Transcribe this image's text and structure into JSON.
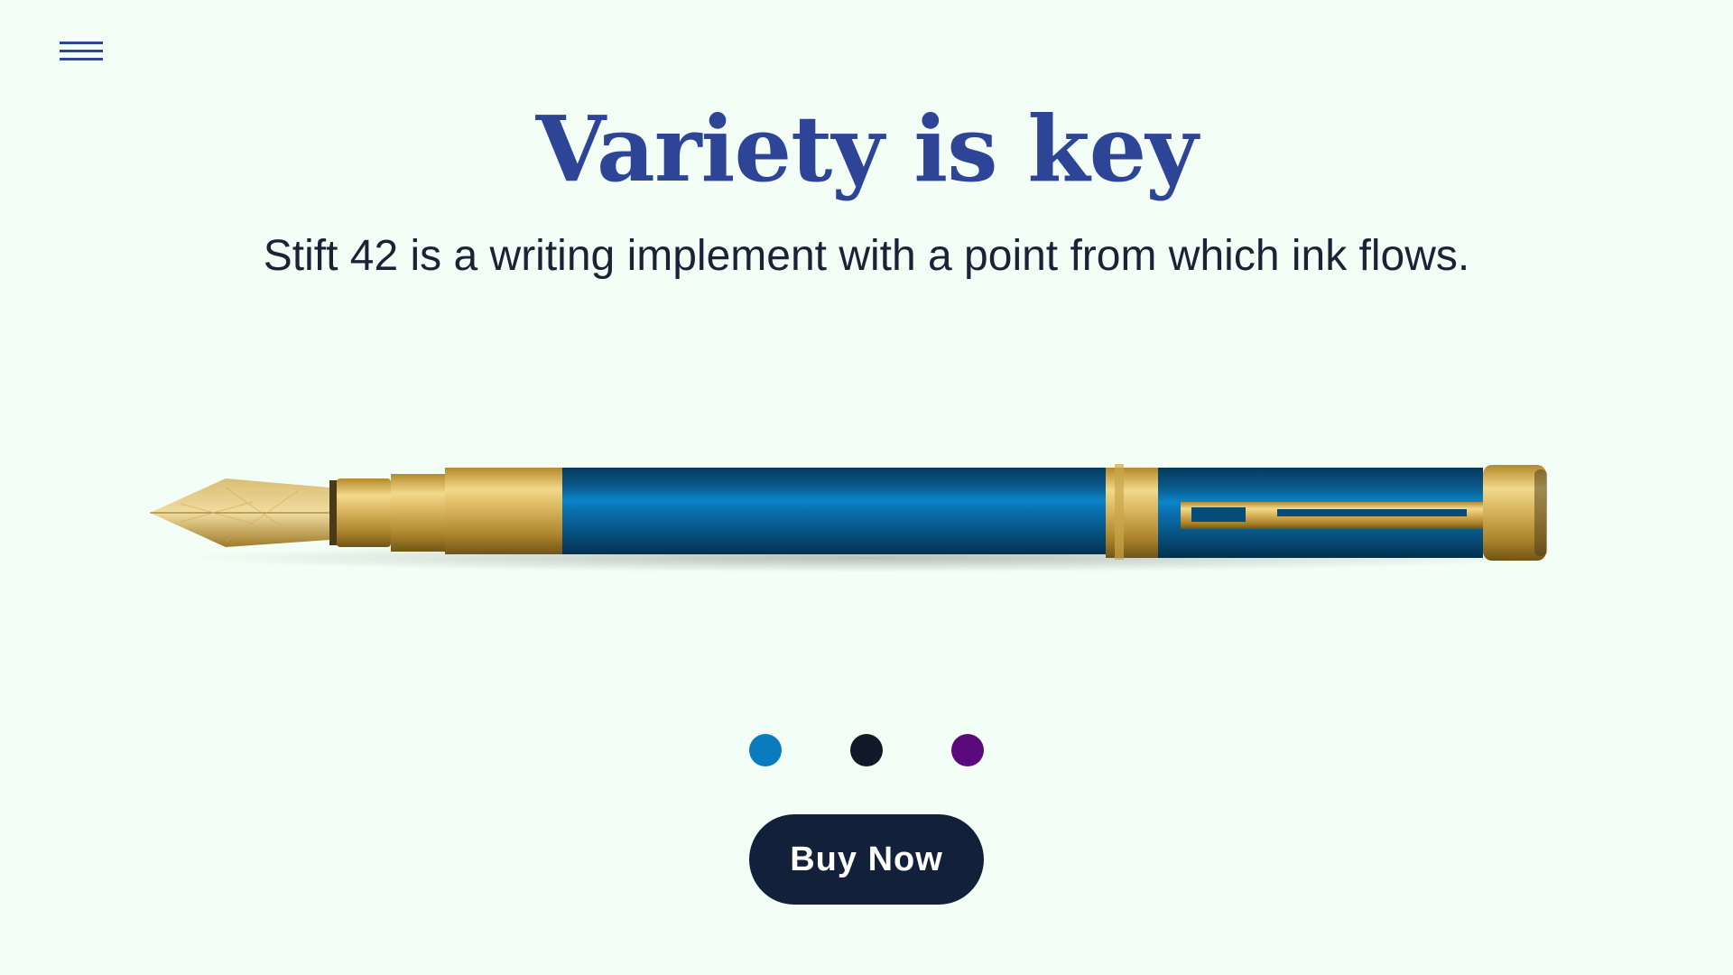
{
  "nav": {
    "menu_icon": "hamburger-menu-icon"
  },
  "hero": {
    "title": "Variety is key",
    "subtitle": "Stift 42 is a writing implement with a point from which ink flows."
  },
  "product": {
    "image": "fountain-pen-image",
    "barrel_color": "#0a5a8c",
    "trim_color": "#c9a64a"
  },
  "colors": {
    "options": [
      {
        "name": "blue",
        "hex": "#0a7bbf"
      },
      {
        "name": "navy",
        "hex": "#111827"
      },
      {
        "name": "purple",
        "hex": "#5b0a7e"
      }
    ]
  },
  "cta": {
    "buy_label": "Buy Now",
    "button_color": "#13203a"
  },
  "theme": {
    "background": "#f3fff6",
    "accent": "#2e4597",
    "text": "#1a2336"
  }
}
